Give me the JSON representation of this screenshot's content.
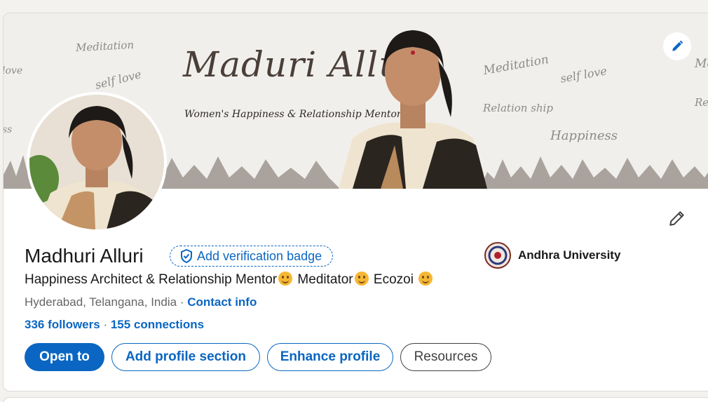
{
  "banner": {
    "title": "Maduri Alluri",
    "subtitle": "Women's Happiness & Relationship Mentor",
    "words": {
      "meditation_left": "Meditation",
      "selflove_left": "self love",
      "love_edge": "love",
      "ss_edge": "ss",
      "meditation_right": "Meditation",
      "selflove_right": "self love",
      "relationship": "Relation ship",
      "happiness": "Happiness",
      "me_edge": "Me",
      "re_edge": "Re"
    }
  },
  "profile": {
    "name": "Madhuri Alluri",
    "verification_label": "Add verification badge",
    "headline_parts": [
      "Happiness Architect & Relationship Mentor",
      " Meditator",
      " Ecozoi "
    ],
    "location": "Hyderabad, Telangana, India",
    "separator": " · ",
    "contact_info": "Contact info",
    "followers": "336 followers",
    "connections_sep": " · ",
    "connections": "155 connections"
  },
  "education": {
    "school": "Andhra University"
  },
  "actions": {
    "open_to": "Open to",
    "add_section": "Add profile section",
    "enhance": "Enhance profile",
    "resources": "Resources"
  },
  "colors": {
    "accent": "#0a66c2",
    "background": "#f4f2ee"
  }
}
